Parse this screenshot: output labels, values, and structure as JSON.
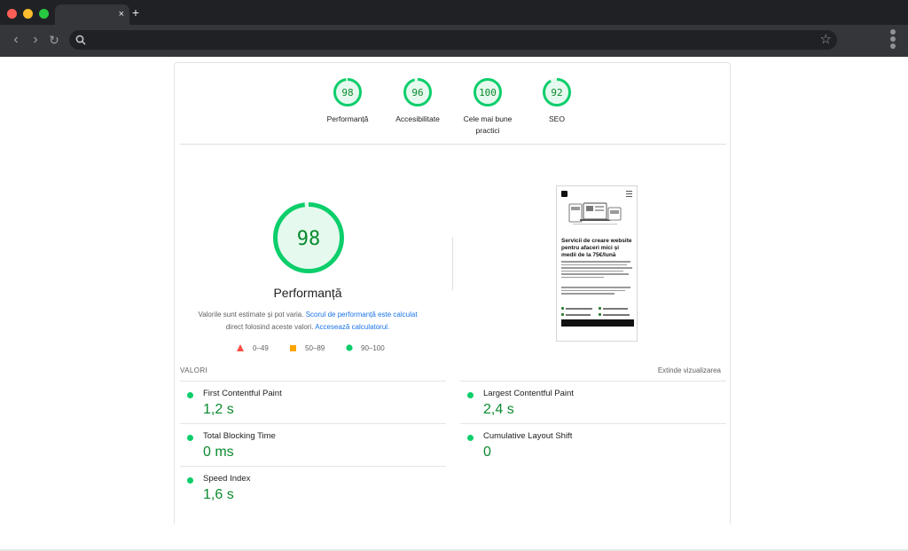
{
  "browser": {
    "tab_close": "×",
    "new_tab": "+",
    "back": "‹",
    "forward": "›",
    "reload": "↻",
    "star": "☆",
    "address": ""
  },
  "categories": [
    {
      "score": "98",
      "label": "Performanță",
      "value": 98
    },
    {
      "score": "96",
      "label": "Accesibilitate",
      "value": 96
    },
    {
      "score": "100",
      "label": "Cele mai bune practici",
      "value": 100
    },
    {
      "score": "92",
      "label": "SEO",
      "value": 92
    }
  ],
  "performance": {
    "score": "98",
    "value": 98,
    "title": "Performanță",
    "desc_prefix": "Valorile sunt estimate și pot varia. ",
    "desc_link1": "Scorul de performanță este calculat",
    "desc_mid": " direct folosind aceste valori. ",
    "desc_link2": "Accesează calculatorul."
  },
  "legend": {
    "fail": "0–49",
    "average": "50–89",
    "pass": "90–100"
  },
  "screenshot": {
    "headline": "Servicii de creare website pentru afaceri mici și medii de la 75€/lună"
  },
  "metrics": {
    "section_label": "VALORI",
    "expand_label": "Extinde vizualizarea",
    "items": [
      {
        "title": "First Contentful Paint",
        "value": "1,2 s"
      },
      {
        "title": "Largest Contentful Paint",
        "value": "2,4 s"
      },
      {
        "title": "Total Blocking Time",
        "value": "0 ms"
      },
      {
        "title": "Cumulative Layout Shift",
        "value": "0"
      },
      {
        "title": "Speed Index",
        "value": "1,6 s"
      }
    ]
  },
  "colors": {
    "pass": "#0cce6b",
    "pass_text": "#0a8a2e",
    "pass_fill": "#e6f9ee",
    "average": "#ffa400",
    "fail": "#ff4e42",
    "link": "#1a73e8"
  }
}
